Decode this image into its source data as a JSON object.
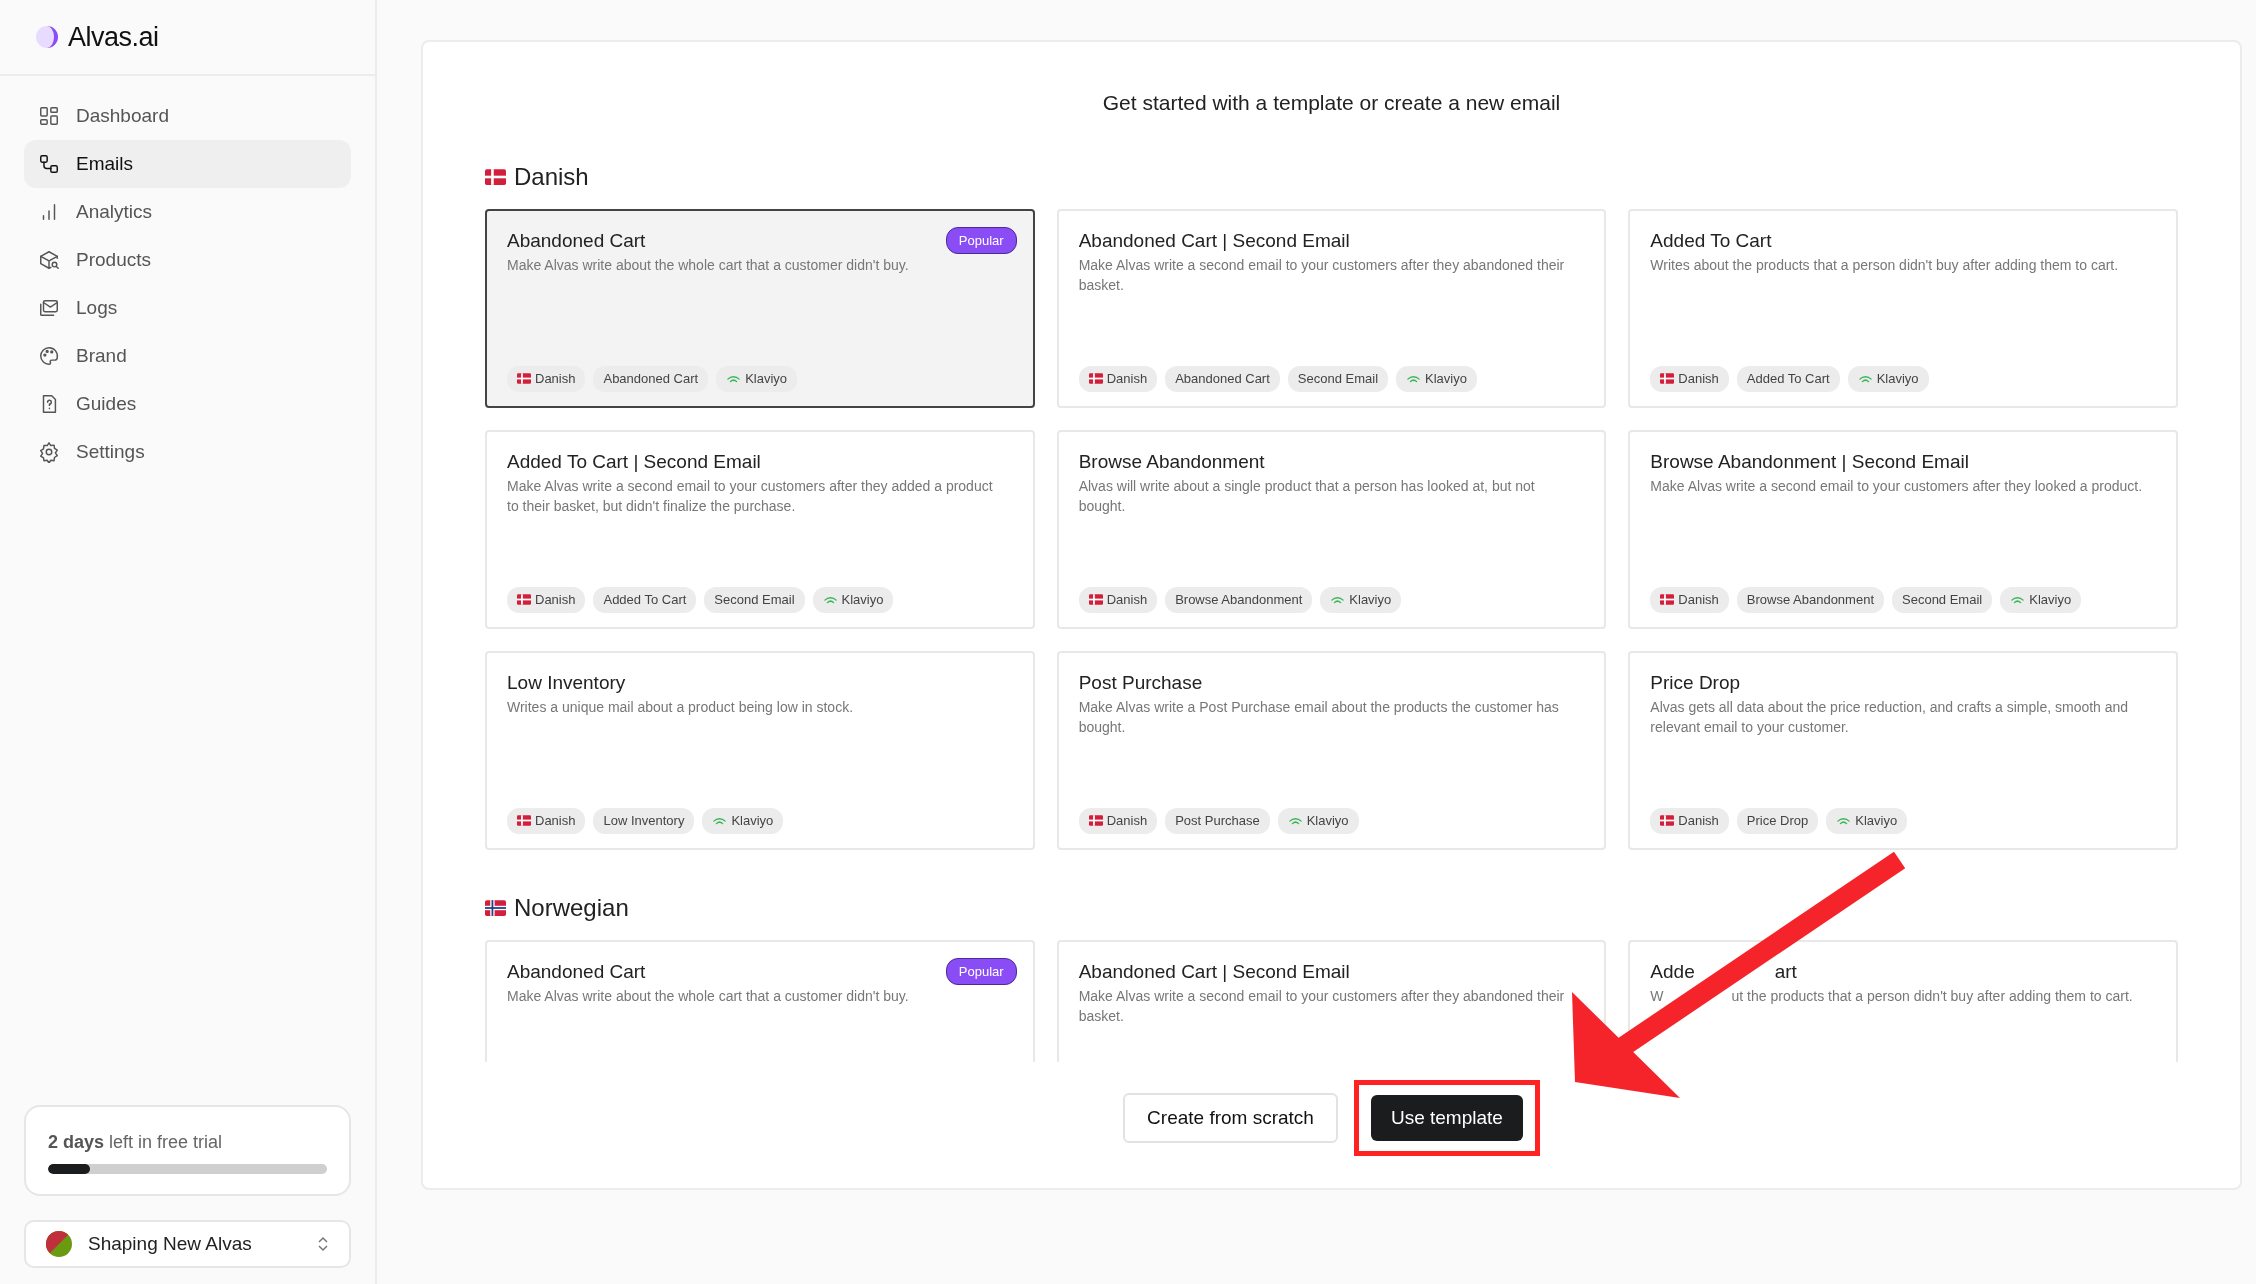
{
  "brand": {
    "name": "Alvas.ai"
  },
  "sidebar": {
    "items": [
      {
        "label": "Dashboard",
        "kind": "dashboard",
        "selected": false
      },
      {
        "label": "Emails",
        "kind": "emails",
        "selected": true
      },
      {
        "label": "Analytics",
        "kind": "analytics",
        "selected": false
      },
      {
        "label": "Products",
        "kind": "products",
        "selected": false
      },
      {
        "label": "Logs",
        "kind": "logs",
        "selected": false
      },
      {
        "label": "Brand",
        "kind": "brand",
        "selected": false
      },
      {
        "label": "Guides",
        "kind": "guides",
        "selected": false
      },
      {
        "label": "Settings",
        "kind": "settings",
        "selected": false
      }
    ],
    "trial": {
      "text": "**2 days** left in free trial",
      "level": 0.15
    },
    "workspace": {
      "name": "Shaping New Alvas"
    }
  },
  "main": {
    "heading": "Get started with a template or create a new email",
    "sections": [
      {
        "name": "Danish",
        "kind": "danish",
        "templates": [
          {
            "title": "Abandoned Cart",
            "description": "Make Alvas write about the whole cart that a customer didn't buy.",
            "badge": "Popular",
            "selected": true,
            "tags": [
              {
                "label": "Danish",
                "kind": "language"
              },
              {
                "label": "Abandoned Cart",
                "kind": "category"
              },
              {
                "label": "Klaviyo",
                "kind": "integration"
              }
            ]
          },
          {
            "title": "Abandoned Cart | Second Email",
            "description": "Make Alvas write a second email to your customers after they abandoned their basket.",
            "selected": false,
            "tags": [
              {
                "label": "Danish",
                "kind": "language"
              },
              {
                "label": "Abandoned Cart",
                "kind": "category"
              },
              {
                "label": "Second Email",
                "kind": "category"
              },
              {
                "label": "Klaviyo",
                "kind": "integration"
              }
            ]
          },
          {
            "title": "Added To Cart",
            "description": "Writes about the products that a person didn't buy after adding them to cart.",
            "selected": false,
            "tags": [
              {
                "label": "Danish",
                "kind": "language"
              },
              {
                "label": "Added To Cart",
                "kind": "category"
              },
              {
                "label": "Klaviyo",
                "kind": "integration"
              }
            ]
          },
          {
            "title": "Added To Cart | Second Email",
            "description": "Make Alvas write a second email to your customers after they added a product to their basket, but didn't finalize the purchase.",
            "selected": false,
            "tags": [
              {
                "label": "Danish",
                "kind": "language"
              },
              {
                "label": "Added To Cart",
                "kind": "category"
              },
              {
                "label": "Second Email",
                "kind": "category"
              },
              {
                "label": "Klaviyo",
                "kind": "integration"
              }
            ]
          },
          {
            "title": "Browse Abandonment",
            "description": "Alvas will write about a single product that a person has looked at, but not bought.",
            "selected": false,
            "tags": [
              {
                "label": "Danish",
                "kind": "language"
              },
              {
                "label": "Browse Abandonment",
                "kind": "category"
              },
              {
                "label": "Klaviyo",
                "kind": "integration"
              }
            ]
          },
          {
            "title": "Browse Abandonment | Second Email",
            "description": "Make Alvas write a second email to your customers after they looked a product.",
            "selected": false,
            "tags": [
              {
                "label": "Danish",
                "kind": "language"
              },
              {
                "label": "Browse Abandonment",
                "kind": "category"
              },
              {
                "label": "Second Email",
                "kind": "category"
              },
              {
                "label": "Klaviyo",
                "kind": "integration"
              }
            ]
          },
          {
            "title": "Low Inventory",
            "description": "Writes a unique mail about a product being low in stock.",
            "selected": false,
            "tags": [
              {
                "label": "Danish",
                "kind": "language"
              },
              {
                "label": "Low Inventory",
                "kind": "category"
              },
              {
                "label": "Klaviyo",
                "kind": "integration"
              }
            ]
          },
          {
            "title": "Post Purchase",
            "description": "Make Alvas write a Post Purchase email about the products the customer has bought.",
            "selected": false,
            "tags": [
              {
                "label": "Danish",
                "kind": "language"
              },
              {
                "label": "Post Purchase",
                "kind": "category"
              },
              {
                "label": "Klaviyo",
                "kind": "integration"
              }
            ]
          },
          {
            "title": "Price Drop",
            "description": "Alvas gets all data about the price reduction, and crafts a simple, smooth and relevant email to your customer.",
            "selected": false,
            "tags": [
              {
                "label": "Danish",
                "kind": "language"
              },
              {
                "label": "Price Drop",
                "kind": "category"
              },
              {
                "label": "Klaviyo",
                "kind": "integration"
              }
            ]
          }
        ]
      },
      {
        "name": "Norwegian",
        "kind": "norwegian",
        "templates": [
          {
            "title": "Abandoned Cart",
            "description": "Make Alvas write about the whole cart that a customer didn't buy.",
            "badge": "Popular",
            "selected": false
          },
          {
            "title": "Abandoned Cart | Second Email",
            "description": "Make Alvas write a second email to your customers after they abandoned their basket.",
            "selected": false
          },
          {
            "title_parts": [
              "Adde",
              "art"
            ],
            "description_parts": [
              "W",
              "ut the products that a person didn't buy after adding them to cart."
            ],
            "selected": false
          }
        ]
      }
    ],
    "buttons": [
      {
        "label": "Create from scratch",
        "kind": "secondary"
      },
      {
        "label": "Use template",
        "kind": "primary",
        "highlighted": true
      }
    ]
  }
}
